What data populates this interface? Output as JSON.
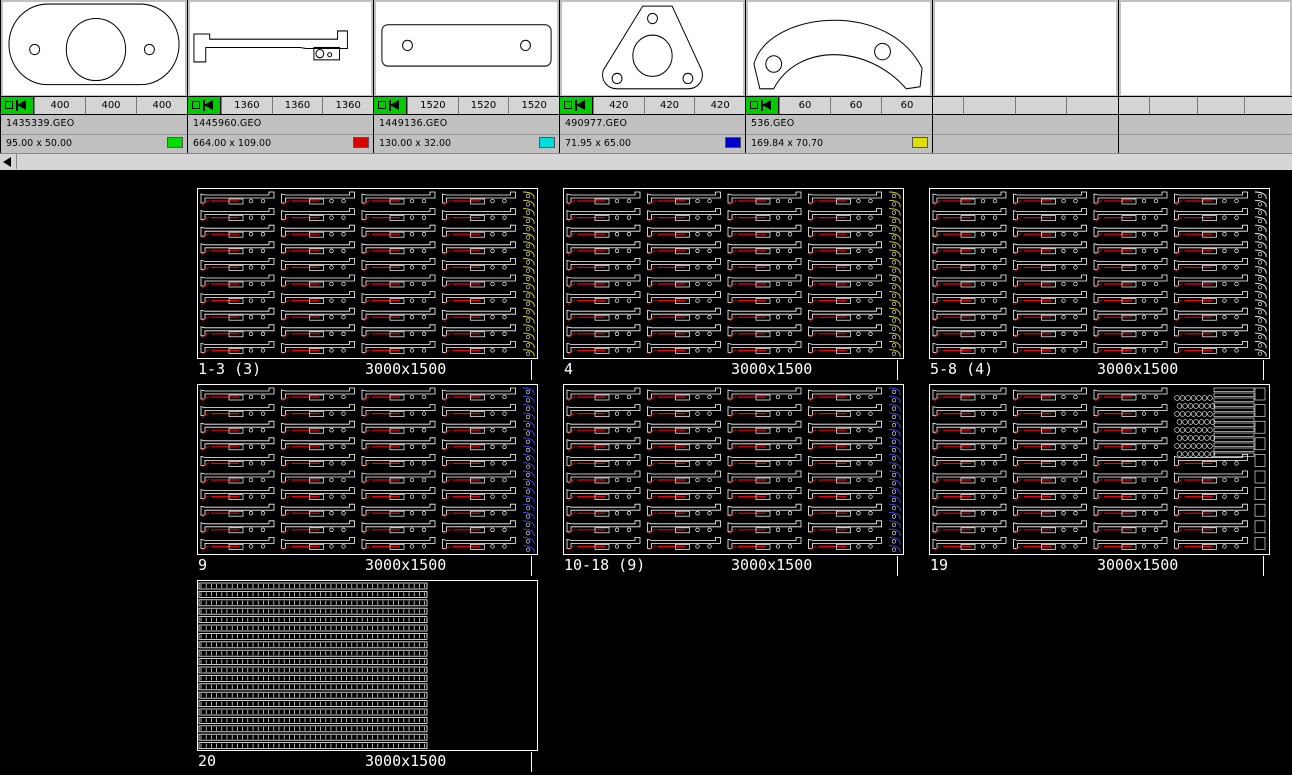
{
  "parts": [
    {
      "shape": "oval-ring",
      "qty": [
        "400",
        "400",
        "400"
      ],
      "file": "1435339.GEO",
      "dims": "95.00 x 50.00",
      "color": "#00dd00"
    },
    {
      "shape": "bracket",
      "qty": [
        "1360",
        "1360",
        "1360"
      ],
      "file": "1445960.GEO",
      "dims": "664.00 x 109.00",
      "color": "#dd0000"
    },
    {
      "shape": "slot-plate",
      "qty": [
        "1520",
        "1520",
        "1520"
      ],
      "file": "1449136.GEO",
      "dims": "130.00 x 32.00",
      "color": "#00dddd"
    },
    {
      "shape": "triangle",
      "qty": [
        "420",
        "420",
        "420"
      ],
      "file": "490977.GEO",
      "dims": "71.95 x 65.00",
      "color": "#0000cc"
    },
    {
      "shape": "arc",
      "qty": [
        "60",
        "60",
        "60"
      ],
      "file": "536.GEO",
      "dims": "169.84 x 70.70",
      "color": "#dddd00"
    }
  ],
  "empty_slots": 2,
  "sheets": [
    {
      "range": "1-3 (3)",
      "size": "3000x1500",
      "variant": "yellow-edge"
    },
    {
      "range": "4",
      "size": "3000x1500",
      "variant": "yellow-edge"
    },
    {
      "range": "5-8 (4)",
      "size": "3000x1500",
      "variant": "white-edge"
    },
    {
      "range": "9",
      "size": "3000x1500",
      "variant": "blue-edge"
    },
    {
      "range": "10-18 (9)",
      "size": "3000x1500",
      "variant": "blue-edge"
    },
    {
      "range": "19",
      "size": "3000x1500",
      "variant": "mixed"
    },
    {
      "range": "20",
      "size": "3000x1500",
      "variant": "dense"
    }
  ]
}
